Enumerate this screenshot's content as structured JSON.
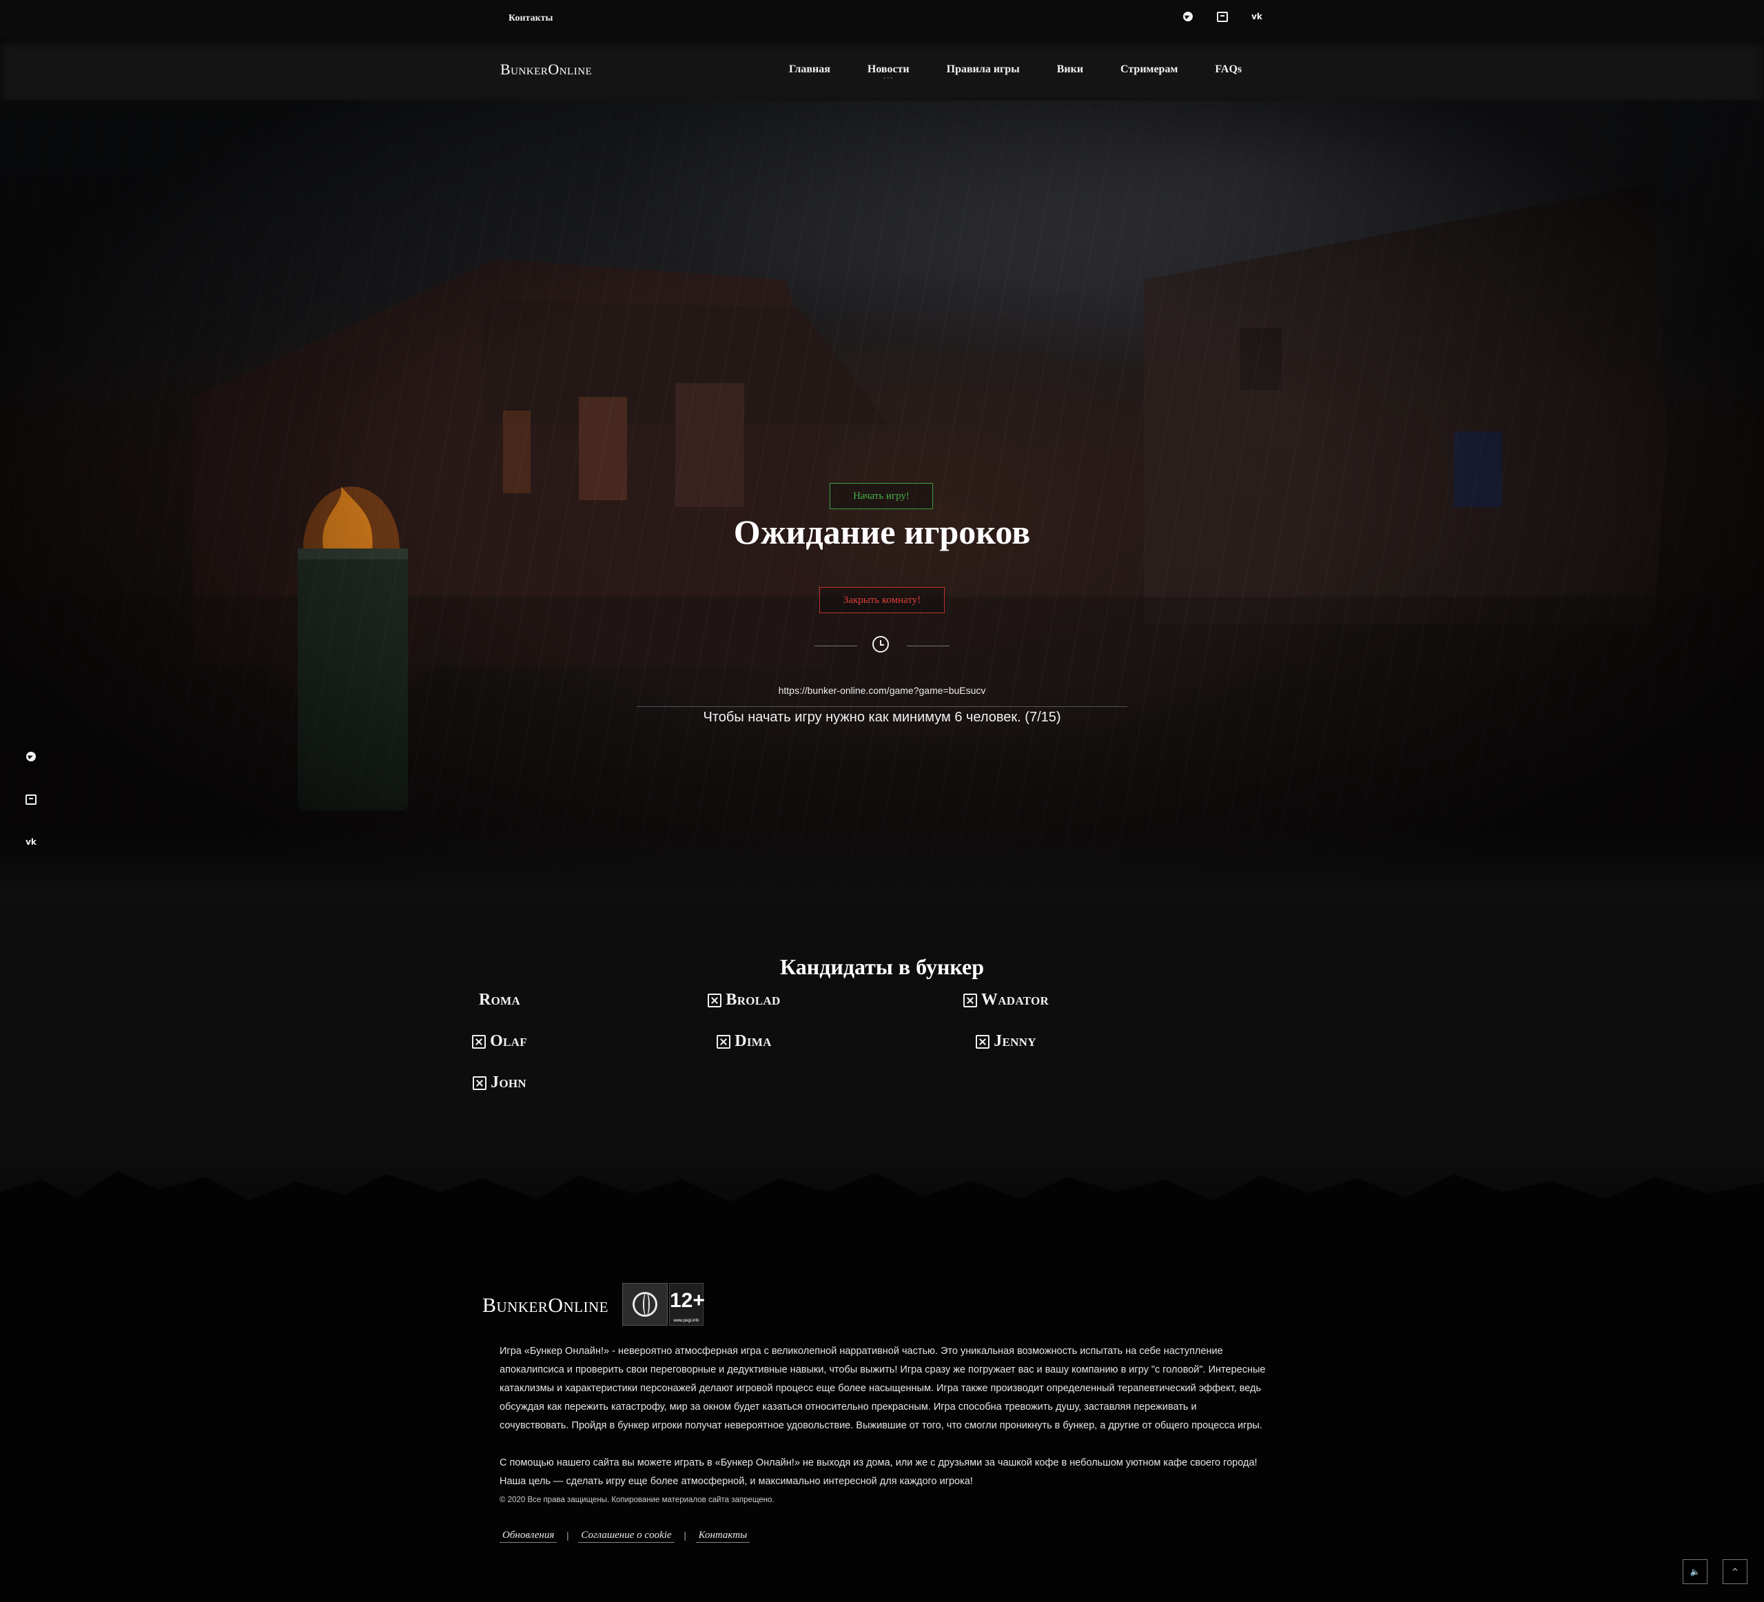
{
  "topbar": {
    "contacts_label": "Контакты",
    "social_icons": [
      "telegram-icon",
      "discord-icon",
      "vk-icon"
    ]
  },
  "navbar": {
    "logo": "BunkerOnline",
    "items": [
      {
        "label": "Главная"
      },
      {
        "label": "Новости"
      },
      {
        "label": "Правила игры"
      },
      {
        "label": "Вики"
      },
      {
        "label": "Стримерам"
      },
      {
        "label": "FAQs"
      }
    ],
    "active_item": "Новости"
  },
  "hero": {
    "start_button": "Начать игру!",
    "title": "Ожидание игроков",
    "close_button": "Закрыть комнату!",
    "game_url": "https://bunker-online.com/game?game=buEsucv",
    "hint": "Чтобы начать игру нужно как минимум 6 человек. (7/15)"
  },
  "candidates": {
    "title": "Кандидаты в бункер",
    "players": [
      {
        "name": "Roma",
        "kickable": false
      },
      {
        "name": "Brolad",
        "kickable": true
      },
      {
        "name": "Wadator",
        "kickable": true
      },
      {
        "name": "Olaf",
        "kickable": true
      },
      {
        "name": "Dima",
        "kickable": true
      },
      {
        "name": "Jenny",
        "kickable": true
      },
      {
        "name": "John",
        "kickable": true
      }
    ]
  },
  "footer": {
    "logo": "BunkerOnline",
    "age_rating": "12+",
    "pegi_site": "www.pegi.info",
    "about_p1": "Игра «Бункер Онлайн!» - невероятно атмосферная игра с великолепной нарративной частью. Это уникальная возможность испытать на себе наступление апокалипсиса и проверить свои переговорные и дедуктивные навыки, чтобы выжить! Игра сразу же погружает вас и вашу компанию в игру \"с головой\". Интересные катаклизмы и характеристики персонажей делают игровой процесс еще более насыщенным. Игра также производит определенный терапевтический эффект, ведь обсуждая как пережить катастрофу, мир за окном будет казаться относительно прекрасным. Игра способна тревожить душу, заставляя переживать и сочувствовать. Пройдя в бункер игроки получат невероятное удовольствие. Выжившие от того, что смогли проникнуть в бункер, а другие от общего процесса игры.",
    "about_p2": "С помощью нашего сайта вы можете играть в «Бункер Онлайн!» не выходя из дома, или же с друзьями за чашкой кофе в небольшом уютном кафе своего города! Наша цель — сделать игру еще более атмосферной, и максимально интересной для каждого игрока!",
    "copyright": "© 2020 Все права защищены. Копирование материалов сайта запрещено.",
    "links": [
      {
        "label": "Обновления"
      },
      {
        "label": "Соглашение о cookie"
      },
      {
        "label": "Контакты"
      }
    ],
    "separator": "|"
  },
  "controls": {
    "sound_icon": "speaker-icon",
    "scroll_top_icon": "chevron-up-icon"
  },
  "colors": {
    "start_green": "#3aa03f",
    "close_red": "#c0322d",
    "background": "#0d0d0d"
  }
}
